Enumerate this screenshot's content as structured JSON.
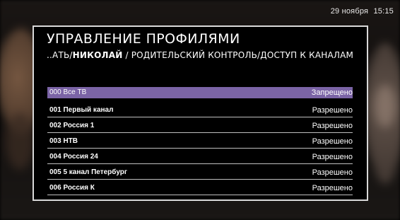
{
  "status_bar": {
    "date": "29 ноября",
    "time": "15:15"
  },
  "dialog": {
    "title": "УПРАВЛЕНИЕ ПРОФИЛЯМИ",
    "breadcrumb_prefix": "..АТЬ/",
    "breadcrumb_profile": "НИКОЛАЙ",
    "breadcrumb_rest": " / РОДИТЕЛЬСКИЙ КОНТРОЛЬ/ДОСТУП К КАНАЛАМ"
  },
  "channels": [
    {
      "name": "000 Все ТВ",
      "status": "Запрещено",
      "selected": true
    },
    {
      "name": "001 Первый канал",
      "status": "Разрешено",
      "selected": false
    },
    {
      "name": "002 Россия 1",
      "status": "Разрешено",
      "selected": false
    },
    {
      "name": "003 НТВ",
      "status": "Разрешено",
      "selected": false
    },
    {
      "name": "004 Россия 24",
      "status": "Разрешено",
      "selected": false
    },
    {
      "name": "005 5 канал Петербург",
      "status": "Разрешено",
      "selected": false
    },
    {
      "name": "006 Россия К",
      "status": "Разрешено",
      "selected": false
    }
  ],
  "colors": {
    "selection": "#7b64a6",
    "border": "#d9d9d9",
    "background": "#000000"
  }
}
